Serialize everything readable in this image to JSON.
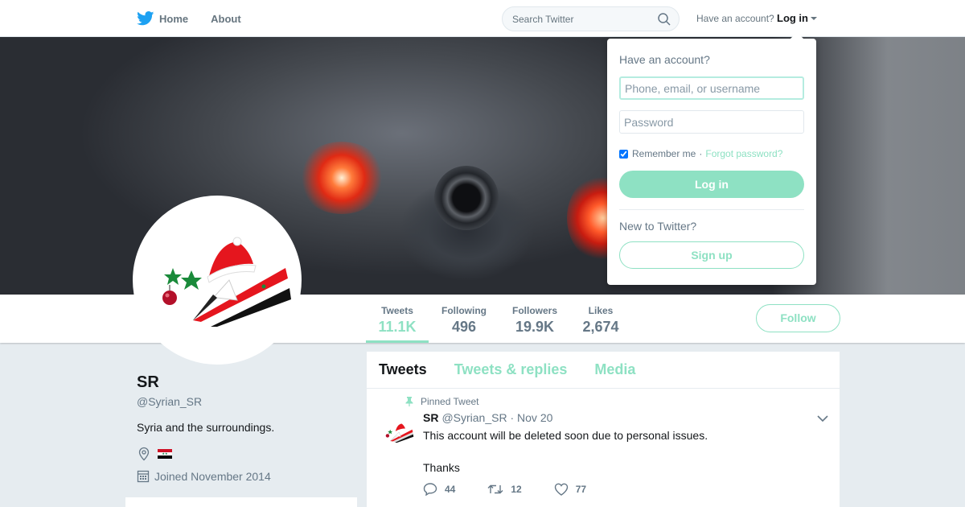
{
  "topnav": {
    "home_label": "Home",
    "about_label": "About",
    "search_placeholder": "Search Twitter",
    "have_account_text": "Have an account?",
    "login_label": "Log in"
  },
  "stats": [
    {
      "label": "Tweets",
      "value": "11.1K"
    },
    {
      "label": "Following",
      "value": "496"
    },
    {
      "label": "Followers",
      "value": "19.9K"
    },
    {
      "label": "Likes",
      "value": "2,674"
    }
  ],
  "follow_label": "Follow",
  "profile": {
    "name": "SR",
    "handle": "@Syrian_SR",
    "bio": "Syria and the surroundings.",
    "joined": "Joined November 2014"
  },
  "tabs": [
    "Tweets",
    "Tweets & replies",
    "Media"
  ],
  "tweet": {
    "pinned_label": "Pinned Tweet",
    "name": "SR",
    "handle": "@Syrian_SR",
    "date": "· Nov 20",
    "line1": "This account will be deleted soon due to personal issues.",
    "line2": "Thanks",
    "replies": "44",
    "retweets": "12",
    "likes": "77"
  },
  "login_dropdown": {
    "title": "Have an account?",
    "username_placeholder": "Phone, email, or username",
    "password_placeholder": "Password",
    "remember_label": "Remember me",
    "separator": "·",
    "forgot_label": "Forgot password?",
    "login_button": "Log in",
    "new_text": "New to Twitter?",
    "signup_button": "Sign up"
  },
  "colors": {
    "accent": "#8ee1c3",
    "twitter_blue": "#1da1f2",
    "text_secondary": "#657786"
  }
}
